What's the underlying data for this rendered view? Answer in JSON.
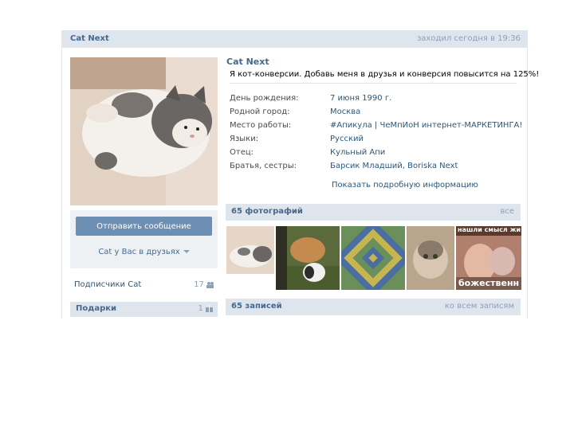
{
  "header": {
    "name": "Cat Next",
    "last_seen": "заходил сегодня в 19:36"
  },
  "profile": {
    "name": "Cat Next",
    "status": "Я кот-конверсии. Добавь меня в друзья и конверсия повысится на 125%!",
    "info": [
      {
        "key": "День рождения:",
        "value": "7 июня 1990 г."
      },
      {
        "key": "Родной город:",
        "value": "Москва"
      },
      {
        "key": "Место работы:",
        "value": "#Апикула | ЧеМпИоН интернет-МАРКЕТИНГА!"
      },
      {
        "key": "Языки:",
        "value": "Русский"
      },
      {
        "key": "Отец:",
        "value": "Кульный Апи"
      },
      {
        "key": "Братья, сестры:",
        "value": "Барсик Младший, Boriska Next"
      }
    ],
    "more_link": "Показать подробную информацию"
  },
  "sidebar": {
    "send_message": "Отправить сообщение",
    "friends_status": "Cat у Вас в друзьях",
    "subscribers_label": "Подписчики Cat",
    "subscribers_count": "17",
    "gifts_label": "Подарки",
    "gifts_count": "1"
  },
  "photos": {
    "label": "65 фотографий",
    "all_link": "все",
    "captions": {
      "p5": "нашли смысл жи",
      "p5_bottom": "божественн"
    }
  },
  "posts": {
    "label": "65 записей",
    "all_link": "ко всем записям"
  },
  "colors": {
    "header_bg": "#dfe5ec",
    "link": "#2b587a",
    "title": "#45688e",
    "button": "#6d8fb3"
  }
}
